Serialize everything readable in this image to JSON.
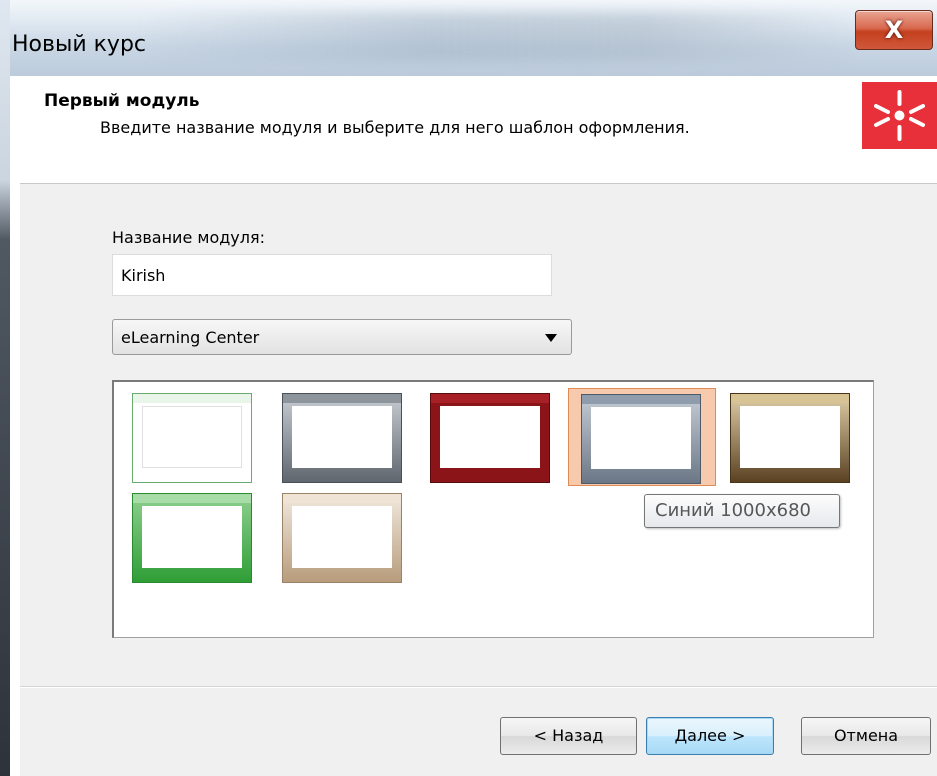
{
  "window": {
    "title": "Новый курс",
    "close_label": "X"
  },
  "header": {
    "title": "Первый модуль",
    "subtitle": "Введите название модуля и выберите для него шаблон оформления.",
    "logo_icon": "ispring-logo-icon",
    "logo_color": "#e7303a"
  },
  "form": {
    "name_label": "Название модуля:",
    "name_value": "Kirish",
    "template_group": "eLearning Center"
  },
  "templates": [
    {
      "name": "white-template",
      "frame_color": "#ffffff",
      "accent": "#7bc47f",
      "selected": false
    },
    {
      "name": "gray-template",
      "frame_color": "#6c727a",
      "accent": "#9aa1a9",
      "selected": false
    },
    {
      "name": "red-template",
      "frame_color": "#8b1418",
      "accent": "#a11c21",
      "selected": false
    },
    {
      "name": "blue-template",
      "frame_color": "#6f7c8c",
      "accent": "#95a3b3",
      "selected": true
    },
    {
      "name": "brown-template",
      "frame_color": "#6b4e2a",
      "accent": "#c9b07a",
      "selected": false
    },
    {
      "name": "green-template",
      "frame_color": "#3fae45",
      "accent": "#7fd07f",
      "selected": false
    },
    {
      "name": "beige-template",
      "frame_color": "#c7b094",
      "accent": "#e6d8c4",
      "selected": false
    }
  ],
  "tooltip": "Синий 1000x680",
  "buttons": {
    "back": "< Назад",
    "next": "Далее >",
    "cancel": "Отмена"
  }
}
